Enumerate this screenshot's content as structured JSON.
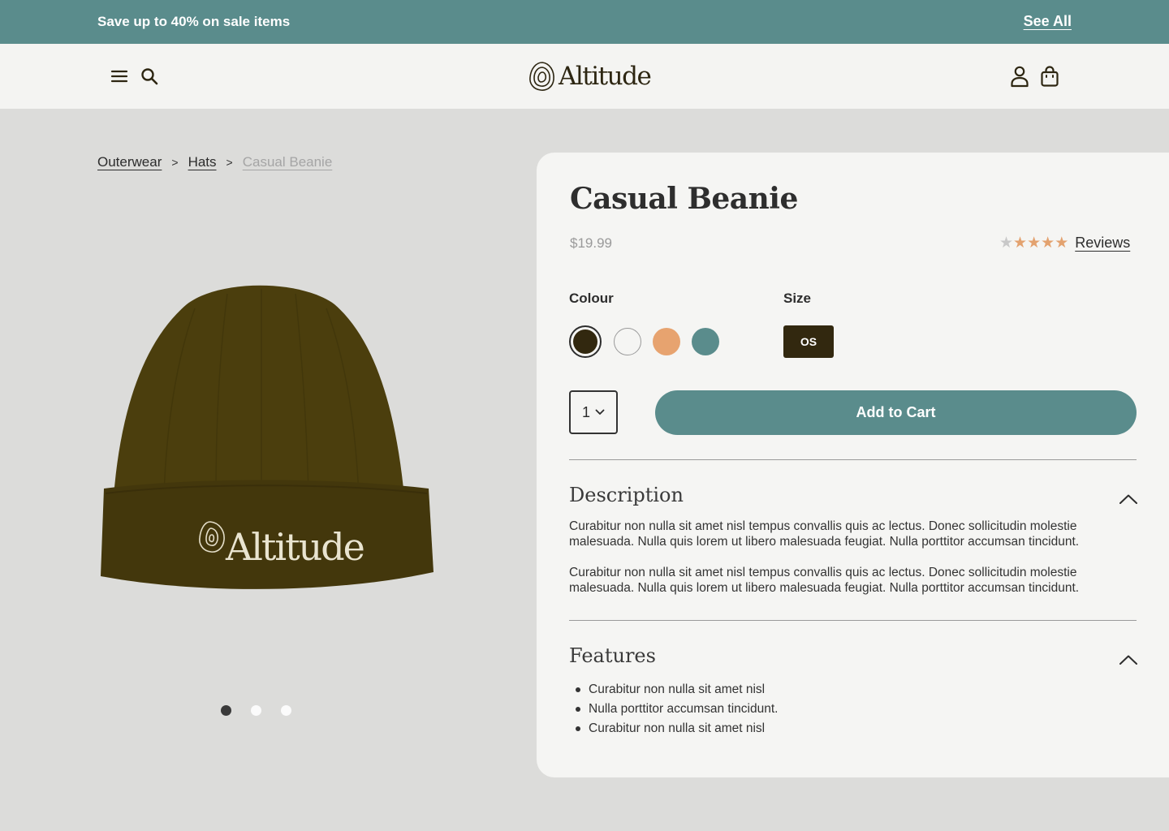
{
  "promo": {
    "message": "Save up to 40% on sale items",
    "link": "See All"
  },
  "header": {
    "brand": "Altitude"
  },
  "breadcrumb": {
    "items": [
      "Outerwear",
      "Hats"
    ],
    "current": "Casual Beanie"
  },
  "product": {
    "title": "Casual Beanie",
    "price": "$19.99",
    "rating": 4,
    "rating_max": 5,
    "reviews_label": "Reviews",
    "image_brand": "Altitude",
    "image_count": 3,
    "image_active": 1,
    "colour_label": "Colour",
    "colours": [
      "#32280f",
      "#f5f5f3",
      "#e7a36f",
      "#5a8c8c"
    ],
    "selected_colour": 0,
    "size_label": "Size",
    "size_value": "OS",
    "quantity": "1",
    "add_to_cart": "Add to Cart"
  },
  "description": {
    "title": "Description",
    "paragraphs": [
      "Curabitur non nulla sit amet nisl tempus convallis quis ac lectus. Donec sollicitudin molestie malesuada. Nulla quis lorem ut libero malesuada feugiat. Nulla porttitor accumsan tincidunt.",
      "Curabitur non nulla sit amet nisl tempus convallis quis ac lectus. Donec sollicitudin molestie malesuada. Nulla quis lorem ut libero malesuada feugiat. Nulla porttitor accumsan tincidunt."
    ]
  },
  "features": {
    "title": "Features",
    "items": [
      "Curabitur non nulla sit amet nisl",
      "Nulla porttitor accumsan tincidunt.",
      "Curabitur non nulla sit amet nisl"
    ]
  },
  "icons": [
    "menu-icon",
    "search-icon",
    "account-icon",
    "bag-icon",
    "chevron-down-icon",
    "chevron-up-icon",
    "star-icon"
  ]
}
